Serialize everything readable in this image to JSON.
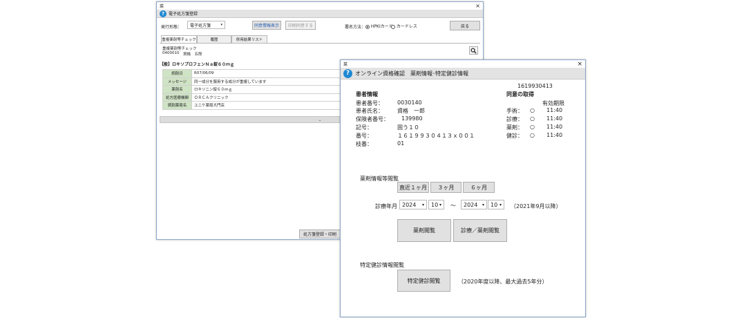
{
  "w1": {
    "title": "電子処方箋登録",
    "close": "×",
    "toolbar": {
      "issue_label": "発行形態：",
      "issue_value": "電子処方箋",
      "consent_btn": "同意情報表示",
      "print_btn": "印刷同意する",
      "sign_label": "署名方法：",
      "sign_hpki": "HPKIカード",
      "sign_cardless": "カードレス",
      "back_btn": "戻る"
    },
    "tabs": [
      "重複薬剤等チェック",
      "履歴",
      "併用結果リスト"
    ],
    "check_title": "重複薬剤等チェック",
    "check_id": "0400010",
    "check_name": "資格　五郎",
    "drug_header": "【般】ロキソプロフェンＮａ錠６０ｍｇ",
    "rows": [
      {
        "k": "調剤日",
        "v": "R07/06/09"
      },
      {
        "k": "メッセージ",
        "v": "同一成分を服用する成分が重複しています"
      },
      {
        "k": "薬剤名",
        "v": "ロキソニン錠６０ｍｇ"
      },
      {
        "k": "処方医療機関",
        "v": "ＯＲＣＡクリニック"
      },
      {
        "k": "調剤薬局名",
        "v": "ユニケ薬局大門店"
      }
    ],
    "divider_arrow": "⌄",
    "register_btn": "処方箋登録・印刷"
  },
  "w2": {
    "window_glyph": "菜",
    "close": "×",
    "title": "オンライン資格確認　薬剤情報･特定健診情報",
    "top_number": "1619930413",
    "patient_heading": "患者情報",
    "patient": [
      {
        "label": "患者番号：",
        "value": "0030140"
      },
      {
        "label": "患者氏名：",
        "value": "資格　一郎"
      },
      {
        "label": "保険者番号：",
        "value": "139980"
      },
      {
        "label": "記号：",
        "value": "固う１０"
      },
      {
        "label": "番号：",
        "value": "１６１９９３０４１３ｘ００１"
      },
      {
        "label": "枝番：",
        "value": "01"
      }
    ],
    "consent_heading": "同意の取得",
    "expiry_heading": "有効期限",
    "consents": [
      {
        "label": "手術：",
        "mark": "○",
        "time": "11:40"
      },
      {
        "label": "診療：",
        "mark": "○",
        "time": "11:40"
      },
      {
        "label": "薬剤：",
        "mark": "○",
        "time": "11:40"
      },
      {
        "label": "健診：",
        "mark": "○",
        "time": "11:40"
      }
    ],
    "drug_section_label": "薬剤情報等閲覧",
    "range_buttons": [
      "直近１ヶ月",
      "３ヶ月",
      "６ヶ月"
    ],
    "visit_label": "診療年月",
    "from_year": "2024",
    "from_month": "10",
    "tilde": "～",
    "to_year": "2024",
    "to_month": "10",
    "date_note": "（2021年9月以降）",
    "drug_view_btn": "薬剤閲覧",
    "clinic_drug_btn": "診療／薬剤閲覧",
    "checkup_label": "特定健診情報閲覧",
    "checkup_btn": "特定健診閲覧",
    "checkup_note": "（2020年度以降、最大過去5年分）"
  }
}
